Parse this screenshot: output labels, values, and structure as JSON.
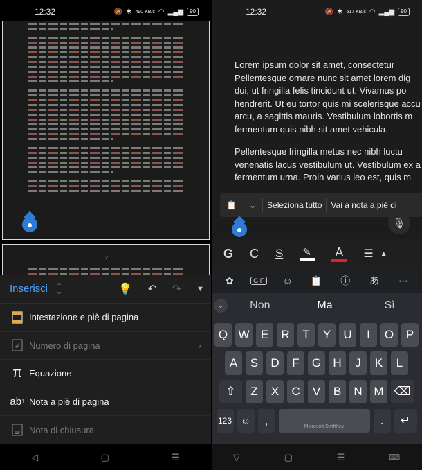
{
  "status_left": {
    "time": "12:32",
    "netspeed": "490 KB/s",
    "battery": "90"
  },
  "status_right": {
    "time": "12:32",
    "netspeed": "517 KB/s",
    "battery": "90"
  },
  "left_doc": {
    "page2_number": "2"
  },
  "insert_ribbon": {
    "tab_label": "Inserisci"
  },
  "insert_menu": {
    "items": [
      {
        "label": "Intestazione e piè di pagina",
        "icon": "header-footer-icon",
        "enabled": true
      },
      {
        "label": "Numero di pagina",
        "icon": "page-number-icon",
        "enabled": false
      },
      {
        "label": "Equazione",
        "icon": "pi-icon",
        "enabled": true
      },
      {
        "label": "Nota a piè di pagina",
        "icon": "footnote-icon",
        "enabled": true
      },
      {
        "label": "Nota di chiusura",
        "icon": "endnote-icon",
        "enabled": false
      }
    ]
  },
  "right_doc": {
    "paragraph1": [
      "Lorem ipsum dolor sit amet, consectetur",
      "Pellentesque ornare nunc sit amet lorem dig",
      "dui, ut fringilla felis tincidunt ut. Vivamus po",
      "hendrerit. Ut eu tortor quis mi scelerisque accu",
      "arcu, a sagittis mauris. Vestibulum lobortis m",
      "fermentum quis nibh sit amet vehicula."
    ],
    "paragraph2": [
      "Pellentesque fringilla metus nec nibh luctu",
      "venenatis lacus vestibulum ut. Vestibulum ex a",
      "fermentum urna. Proin varius leo est, quis m"
    ]
  },
  "context_menu": {
    "select_all": "Seleziona tutto",
    "go_to_footnote": "Vai a nota a piè di"
  },
  "format_bar": {
    "bold": "G",
    "italic": "C",
    "underline": "S",
    "font_color_letter": "A",
    "font_color": "#e0202a"
  },
  "keyboard": {
    "suggestions": [
      "Non",
      "Ma",
      "Sì"
    ],
    "row1": [
      "Q",
      "W",
      "E",
      "R",
      "T",
      "Y",
      "U",
      "I",
      "O",
      "P"
    ],
    "row2": [
      "A",
      "S",
      "D",
      "F",
      "G",
      "H",
      "J",
      "K",
      "L"
    ],
    "row3": [
      "Z",
      "X",
      "C",
      "V",
      "B",
      "N",
      "M"
    ],
    "numbers_key": "123",
    "comma_key": ",",
    "period_key": ".",
    "space_label": "Microsoft SwiftKey"
  },
  "colors": {
    "accent": "#4aa3ff",
    "handle": "#2e7bd6"
  }
}
